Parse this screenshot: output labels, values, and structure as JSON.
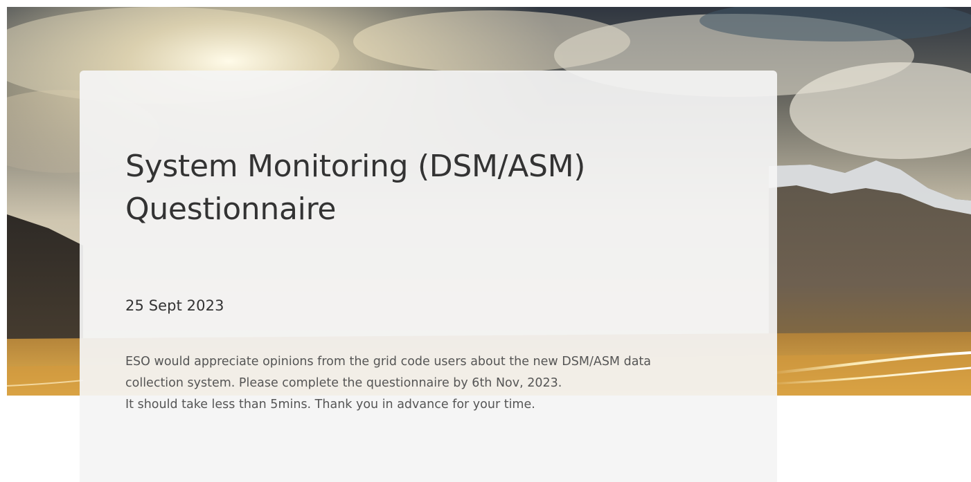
{
  "banner": {
    "image": "mountain-landscape-with-light-trails",
    "colors": {
      "sky_dark": "#3a3f45",
      "sky_light": "#e8e2d4",
      "sun_glow": "#fff6dc",
      "mountain": "#5a4f40",
      "snow": "#e9ecef",
      "ground_gold": "#d9a640"
    }
  },
  "form": {
    "title": "System Monitoring (DSM/ASM) Questionnaire",
    "date": "25 Sept 2023",
    "description_line1": "ESO would appreciate opinions from the grid code users about the new DSM/ASM data collection system. Please complete the questionnaire by 6th Nov, 2023.",
    "description_line2": "It should take less than 5mins. Thank you in advance for your time."
  }
}
